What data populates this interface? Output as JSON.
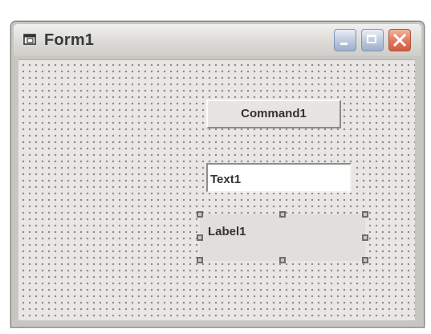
{
  "window": {
    "title": "Form1",
    "icon": "form-icon",
    "controls": {
      "minimize": "minimize-icon",
      "maximize": "maximize-icon",
      "close": "close-icon"
    }
  },
  "form": {
    "command_button": {
      "label": "Command1"
    },
    "text_box": {
      "value": "Text1"
    },
    "label": {
      "text": "Label1",
      "selected": true
    }
  },
  "colors": {
    "client_background": "#e8e7e4",
    "grid_dot": "#8e8d89",
    "close_button": "#e2755a",
    "title_buttons": "#b8c5da"
  }
}
